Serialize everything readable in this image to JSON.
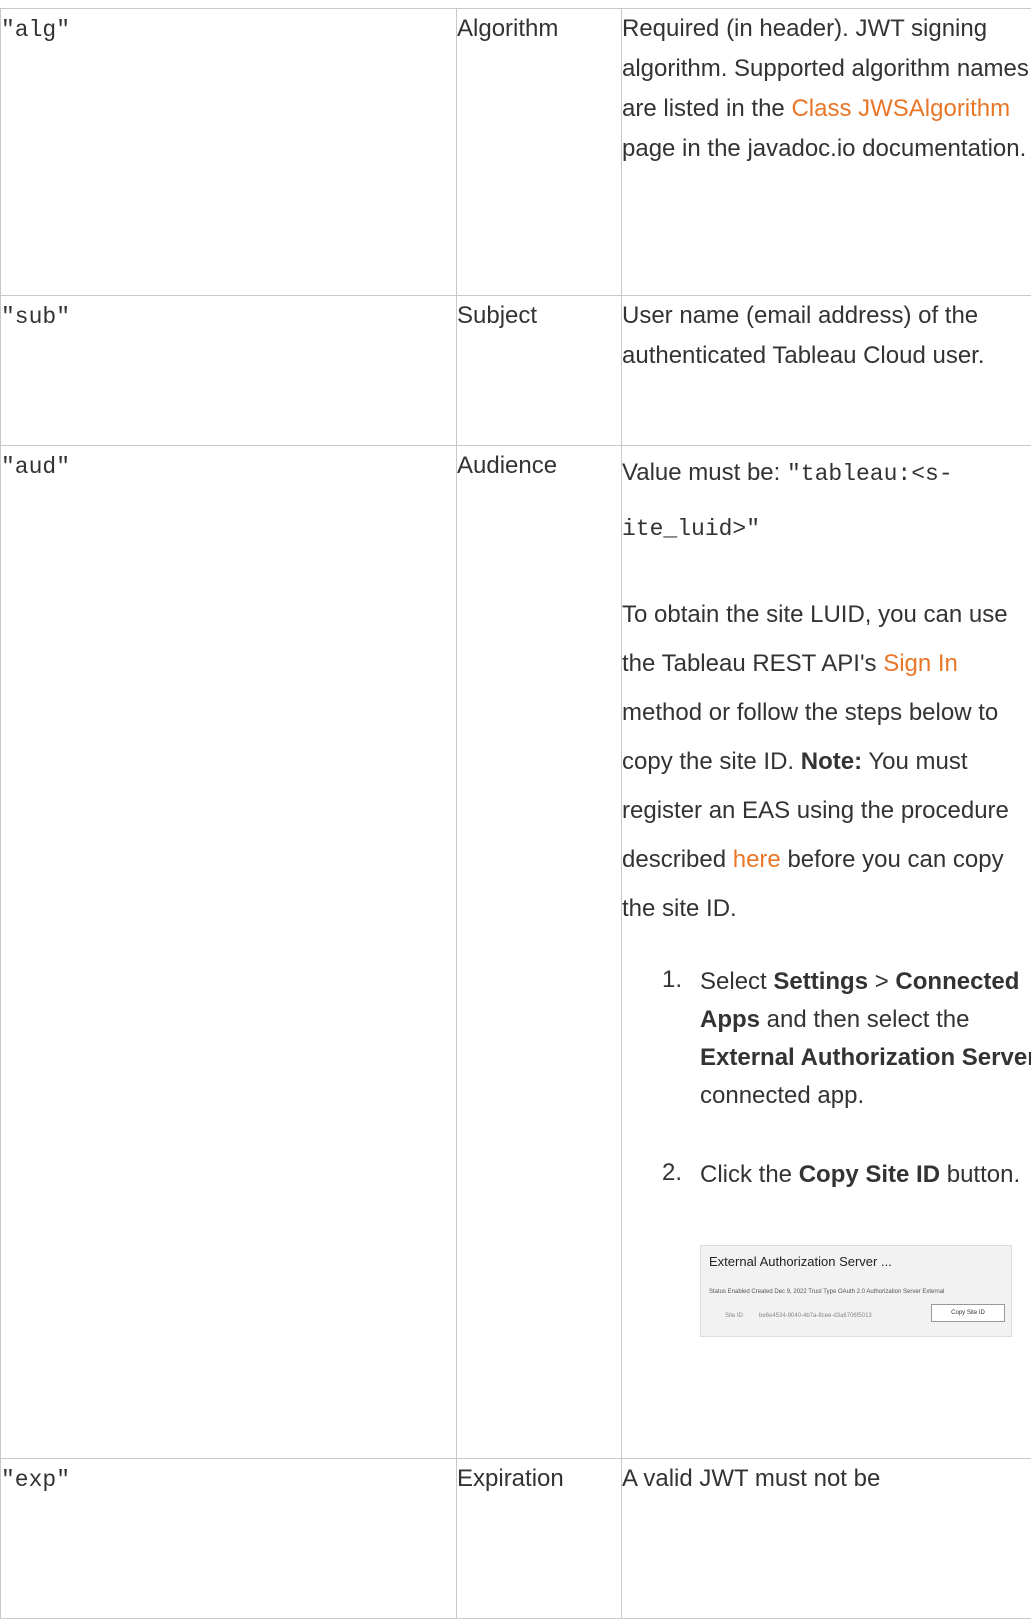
{
  "rows": [
    {
      "claim": "\"alg\"",
      "name": "Algorithm",
      "desc_pre": "Required (in header). JWT sign­ing algorithm. Supported algorithm names are listed in the ",
      "desc_link": "Class JWSAlgorithm",
      "desc_post": " page in the javadoc.io doc­umentation."
    },
    {
      "claim": "\"sub\"",
      "name": "Subject",
      "desc": "User name (email address) of the authenticated Tableau Cloud user."
    },
    {
      "claim": "\"aud\"",
      "name": "Audience",
      "value_prefix": "Value must be: ",
      "value_code": "\"tableau:<s­ite_luid>\"",
      "luid_pre": "To obtain the site LUID, you can use the Tableau REST API's ",
      "luid_link": "Sign In",
      "luid_post": " method or follow the steps below to copy the site ID.",
      "note_label": "Note:",
      "note_pre": " You must register an EAS using the procedure described ",
      "note_link": "here",
      "note_post": " before you can copy the site ID.",
      "step1": {
        "num": "1.",
        "pre": "Select ",
        "b1": "Settings",
        "mid1": " > ",
        "b2": "Con­nected Apps",
        "mid2": " and then select the ",
        "b3": "External Authorization Server",
        "post": " connected app."
      },
      "step2": {
        "num": "2.",
        "pre": "Click the ",
        "b1": "Copy Site ID",
        "post": " button."
      },
      "screenshot": {
        "title": "External Authorization Server  ...",
        "status_line": "Status Enabled   Created Dec 9, 2022   Trust Type OAuth 2.0   Authorization Server External",
        "site_label": "Site ID",
        "site_id": "be6e4534-9040-4b7a-8cee-d3a6706f5013",
        "button": "Copy Site ID"
      }
    },
    {
      "claim": "\"exp\"",
      "name": "Expiration",
      "desc": "A valid JWT must not be"
    }
  ]
}
